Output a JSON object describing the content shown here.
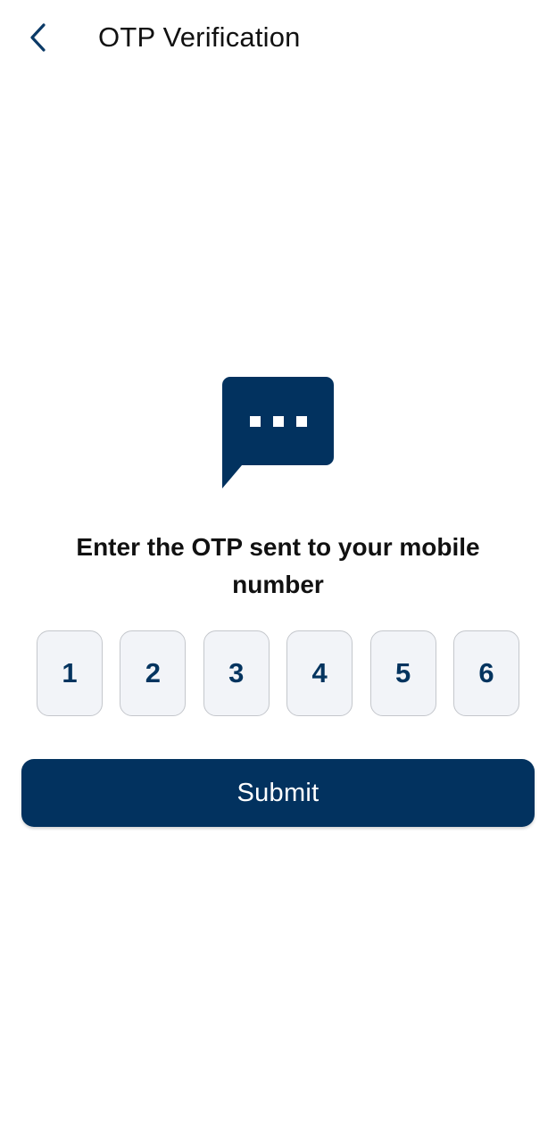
{
  "header": {
    "back_icon": "chevron-left-icon",
    "title": "OTP Verification"
  },
  "hero": {
    "icon": "chat-bubble-dots-icon"
  },
  "instruction": {
    "text": "Enter the OTP sent to your mobile number"
  },
  "otp": {
    "digits": [
      "1",
      "2",
      "3",
      "4",
      "5",
      "6"
    ]
  },
  "actions": {
    "submit_label": "Submit"
  },
  "colors": {
    "brand": "#02325f",
    "digit": "#04345f",
    "box_fill": "#f2f4f8",
    "box_border": "#c4c7cc"
  }
}
